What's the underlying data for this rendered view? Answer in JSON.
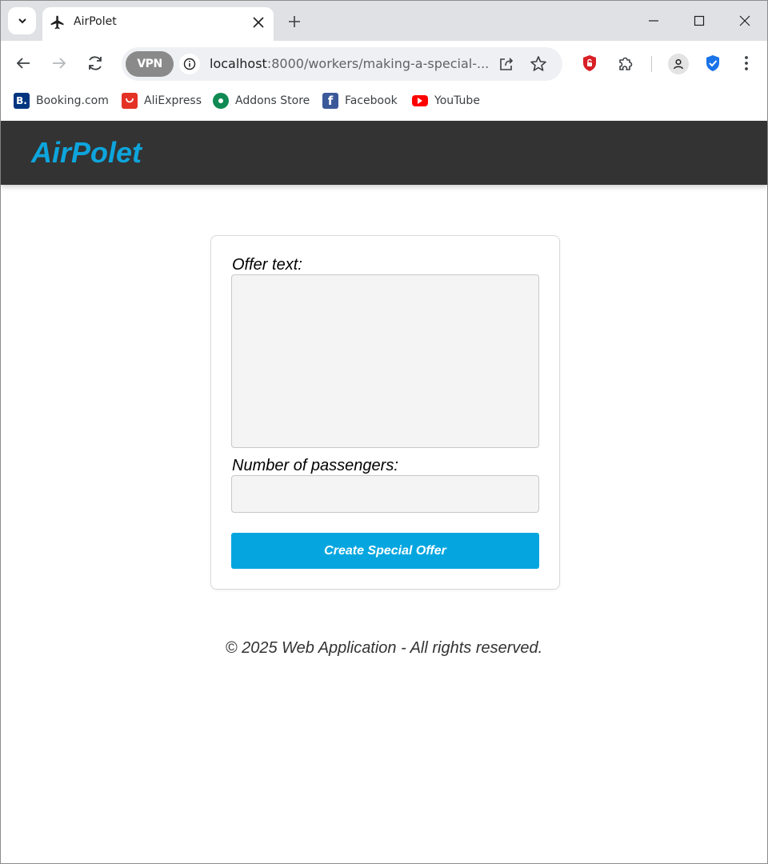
{
  "browser": {
    "tab": {
      "title": "AirPolet",
      "favicon": "airplane-icon"
    },
    "omnibox": {
      "vpn_label": "VPN",
      "url_host": "localhost",
      "url_rest": ":8000/workers/making-a-special-..."
    },
    "bookmarks": [
      {
        "label": "Booking.com",
        "icon": "booking-icon",
        "color": "#003580",
        "glyph": "B."
      },
      {
        "label": "AliExpress",
        "icon": "aliexpress-icon",
        "color": "#e43225",
        "glyph": ""
      },
      {
        "label": "Addons Store",
        "icon": "addons-store-icon",
        "color": "#0f8a52",
        "glyph": ""
      },
      {
        "label": "Facebook",
        "icon": "facebook-icon",
        "color": "#3b5998",
        "glyph": "f"
      },
      {
        "label": "YouTube",
        "icon": "youtube-icon",
        "color": "#ff0000",
        "glyph": ""
      }
    ]
  },
  "app": {
    "brand": "AirPolet",
    "brand_color": "#0ea5dc",
    "header_color": "#333333"
  },
  "form": {
    "offer_text_label": "Offer text:",
    "offer_text_value": "",
    "passengers_label": "Number of passengers:",
    "passengers_value": "",
    "submit_label": "Create Special Offer",
    "submit_color": "#05a6df"
  },
  "footer": {
    "text": "© 2025 Web Application - All rights reserved."
  }
}
